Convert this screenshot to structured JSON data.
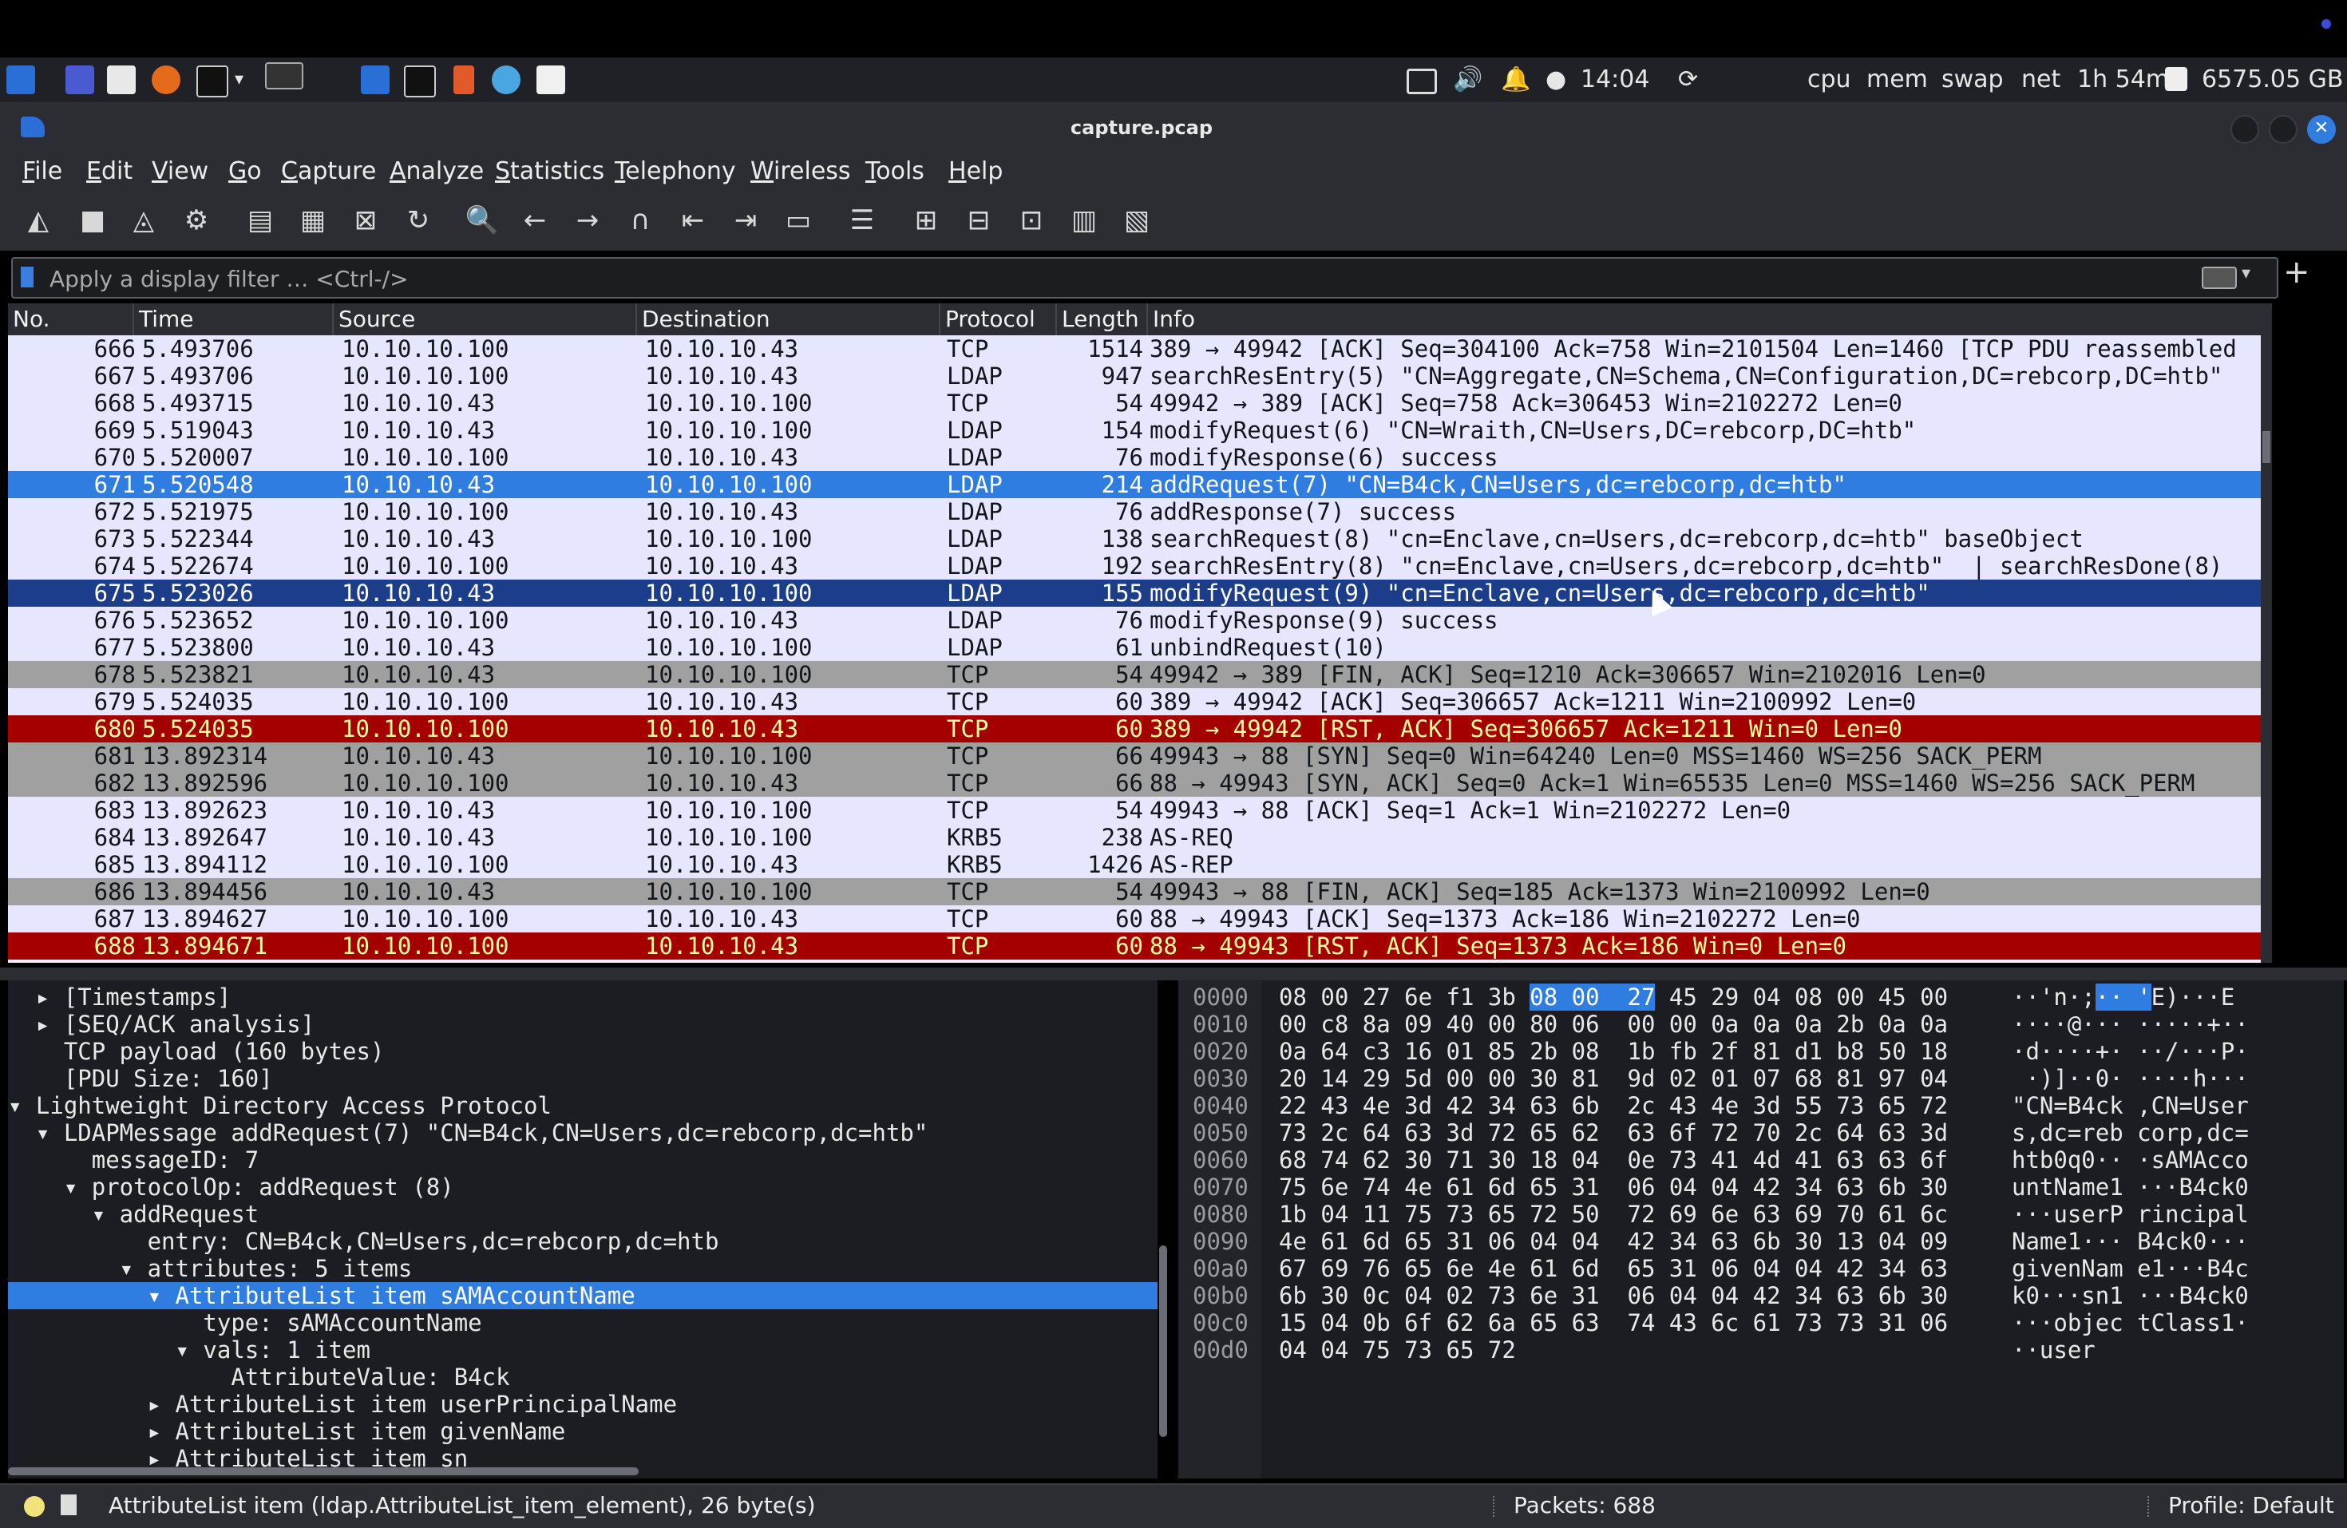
{
  "taskbar": {
    "clock": "14:04",
    "monitors": [
      "cpu",
      "mem",
      "swap",
      "net"
    ],
    "uptime": "1h 54m",
    "disk": "6575.05 GB"
  },
  "window": {
    "title": "capture.pcap"
  },
  "menu": [
    "File",
    "Edit",
    "View",
    "Go",
    "Capture",
    "Analyze",
    "Statistics",
    "Telephony",
    "Wireless",
    "Tools",
    "Help"
  ],
  "filter": {
    "placeholder": "Apply a display filter … <Ctrl-/>"
  },
  "columns": [
    "No.",
    "Time",
    "Source",
    "Destination",
    "Protocol",
    "Length",
    "Info"
  ],
  "packets": [
    {
      "no": "666",
      "time": "5.493706",
      "src": "10.10.10.100",
      "dst": "10.10.10.43",
      "proto": "TCP",
      "len": "1514",
      "info": "389 → 49942 [ACK] Seq=304100 Ack=758 Win=2101504 Len=1460 [TCP PDU reassembled",
      "style": "normal"
    },
    {
      "no": "667",
      "time": "5.493706",
      "src": "10.10.10.100",
      "dst": "10.10.10.43",
      "proto": "LDAP",
      "len": "947",
      "info": "searchResEntry(5) \"CN=Aggregate,CN=Schema,CN=Configuration,DC=rebcorp,DC=htb\"",
      "style": "normal"
    },
    {
      "no": "668",
      "time": "5.493715",
      "src": "10.10.10.43",
      "dst": "10.10.10.100",
      "proto": "TCP",
      "len": "54",
      "info": "49942 → 389 [ACK] Seq=758 Ack=306453 Win=2102272 Len=0",
      "style": "normal"
    },
    {
      "no": "669",
      "time": "5.519043",
      "src": "10.10.10.43",
      "dst": "10.10.10.100",
      "proto": "LDAP",
      "len": "154",
      "info": "modifyRequest(6) \"CN=Wraith,CN=Users,DC=rebcorp,DC=htb\"",
      "style": "normal"
    },
    {
      "no": "670",
      "time": "5.520007",
      "src": "10.10.10.100",
      "dst": "10.10.10.43",
      "proto": "LDAP",
      "len": "76",
      "info": "modifyResponse(6) success",
      "style": "normal"
    },
    {
      "no": "671",
      "time": "5.520548",
      "src": "10.10.10.43",
      "dst": "10.10.10.100",
      "proto": "LDAP",
      "len": "214",
      "info": "addRequest(7) \"CN=B4ck,CN=Users,dc=rebcorp,dc=htb\"",
      "style": "sel1"
    },
    {
      "no": "672",
      "time": "5.521975",
      "src": "10.10.10.100",
      "dst": "10.10.10.43",
      "proto": "LDAP",
      "len": "76",
      "info": "addResponse(7) success",
      "style": "normal"
    },
    {
      "no": "673",
      "time": "5.522344",
      "src": "10.10.10.43",
      "dst": "10.10.10.100",
      "proto": "LDAP",
      "len": "138",
      "info": "searchRequest(8) \"cn=Enclave,cn=Users,dc=rebcorp,dc=htb\" baseObject",
      "style": "normal"
    },
    {
      "no": "674",
      "time": "5.522674",
      "src": "10.10.10.100",
      "dst": "10.10.10.43",
      "proto": "LDAP",
      "len": "192",
      "info": "searchResEntry(8) \"cn=Enclave,cn=Users,dc=rebcorp,dc=htb\"  | searchResDone(8)",
      "style": "normal"
    },
    {
      "no": "675",
      "time": "5.523026",
      "src": "10.10.10.43",
      "dst": "10.10.10.100",
      "proto": "LDAP",
      "len": "155",
      "info": "modifyRequest(9) \"cn=Enclave,cn=Users,dc=rebcorp,dc=htb\"",
      "style": "sel2"
    },
    {
      "no": "676",
      "time": "5.523652",
      "src": "10.10.10.100",
      "dst": "10.10.10.43",
      "proto": "LDAP",
      "len": "76",
      "info": "modifyResponse(9) success",
      "style": "normal"
    },
    {
      "no": "677",
      "time": "5.523800",
      "src": "10.10.10.43",
      "dst": "10.10.10.100",
      "proto": "LDAP",
      "len": "61",
      "info": "unbindRequest(10)",
      "style": "normal"
    },
    {
      "no": "678",
      "time": "5.523821",
      "src": "10.10.10.43",
      "dst": "10.10.10.100",
      "proto": "TCP",
      "len": "54",
      "info": "49942 → 389 [FIN, ACK] Seq=1210 Ack=306657 Win=2102016 Len=0",
      "style": "gray"
    },
    {
      "no": "679",
      "time": "5.524035",
      "src": "10.10.10.100",
      "dst": "10.10.10.43",
      "proto": "TCP",
      "len": "60",
      "info": "389 → 49942 [ACK] Seq=306657 Ack=1211 Win=2100992 Len=0",
      "style": "normal"
    },
    {
      "no": "680",
      "time": "5.524035",
      "src": "10.10.10.100",
      "dst": "10.10.10.43",
      "proto": "TCP",
      "len": "60",
      "info": "389 → 49942 [RST, ACK] Seq=306657 Ack=1211 Win=0 Len=0",
      "style": "red"
    },
    {
      "no": "681",
      "time": "13.892314",
      "src": "10.10.10.43",
      "dst": "10.10.10.100",
      "proto": "TCP",
      "len": "66",
      "info": "49943 → 88 [SYN] Seq=0 Win=64240 Len=0 MSS=1460 WS=256 SACK_PERM",
      "style": "gray"
    },
    {
      "no": "682",
      "time": "13.892596",
      "src": "10.10.10.100",
      "dst": "10.10.10.43",
      "proto": "TCP",
      "len": "66",
      "info": "88 → 49943 [SYN, ACK] Seq=0 Ack=1 Win=65535 Len=0 MSS=1460 WS=256 SACK_PERM",
      "style": "gray"
    },
    {
      "no": "683",
      "time": "13.892623",
      "src": "10.10.10.43",
      "dst": "10.10.10.100",
      "proto": "TCP",
      "len": "54",
      "info": "49943 → 88 [ACK] Seq=1 Ack=1 Win=2102272 Len=0",
      "style": "normal"
    },
    {
      "no": "684",
      "time": "13.892647",
      "src": "10.10.10.43",
      "dst": "10.10.10.100",
      "proto": "KRB5",
      "len": "238",
      "info": "AS-REQ",
      "style": "normal"
    },
    {
      "no": "685",
      "time": "13.894112",
      "src": "10.10.10.100",
      "dst": "10.10.10.43",
      "proto": "KRB5",
      "len": "1426",
      "info": "AS-REP",
      "style": "normal"
    },
    {
      "no": "686",
      "time": "13.894456",
      "src": "10.10.10.43",
      "dst": "10.10.10.100",
      "proto": "TCP",
      "len": "54",
      "info": "49943 → 88 [FIN, ACK] Seq=185 Ack=1373 Win=2100992 Len=0",
      "style": "gray"
    },
    {
      "no": "687",
      "time": "13.894627",
      "src": "10.10.10.100",
      "dst": "10.10.10.43",
      "proto": "TCP",
      "len": "60",
      "info": "88 → 49943 [ACK] Seq=1373 Ack=186 Win=2102272 Len=0",
      "style": "normal"
    },
    {
      "no": "688",
      "time": "13.894671",
      "src": "10.10.10.100",
      "dst": "10.10.10.43",
      "proto": "TCP",
      "len": "60",
      "info": "88 → 49943 [RST, ACK] Seq=1373 Ack=186 Win=0 Len=0",
      "style": "red"
    }
  ],
  "details": [
    {
      "text": "  ▸ [Timestamps]",
      "sel": false
    },
    {
      "text": "  ▸ [SEQ/ACK analysis]",
      "sel": false
    },
    {
      "text": "    TCP payload (160 bytes)",
      "sel": false
    },
    {
      "text": "    [PDU Size: 160]",
      "sel": false
    },
    {
      "text": "▾ Lightweight Directory Access Protocol",
      "sel": false
    },
    {
      "text": "  ▾ LDAPMessage addRequest(7) \"CN=B4ck,CN=Users,dc=rebcorp,dc=htb\"",
      "sel": false
    },
    {
      "text": "      messageID: 7",
      "sel": false
    },
    {
      "text": "    ▾ protocolOp: addRequest (8)",
      "sel": false
    },
    {
      "text": "      ▾ addRequest",
      "sel": false
    },
    {
      "text": "          entry: CN=B4ck,CN=Users,dc=rebcorp,dc=htb",
      "sel": false
    },
    {
      "text": "        ▾ attributes: 5 items",
      "sel": false
    },
    {
      "text": "          ▾ AttributeList item sAMAccountName",
      "sel": true
    },
    {
      "text": "              type: sAMAccountName",
      "sel": false
    },
    {
      "text": "            ▾ vals: 1 item",
      "sel": false
    },
    {
      "text": "                AttributeValue: B4ck",
      "sel": false
    },
    {
      "text": "          ▸ AttributeList item userPrincipalName",
      "sel": false
    },
    {
      "text": "          ▸ AttributeList item givenName",
      "sel": false
    },
    {
      "text": "          ▸ AttributeList item sn",
      "sel": false
    }
  ],
  "hex": [
    {
      "off": "0000",
      "bytes": "08 00 27 6e f1 3b ",
      "hl": "08 00  27",
      "bytes2": " 45 29 04 08 00 45 00",
      "asc_a": "··'n·;",
      "asc_hl": "·· '",
      "asc_b": "E)···E"
    },
    {
      "off": "0010",
      "bytes": "00 c8 8a 09 40 00 80 06  00 00 0a 0a 0a 2b 0a 0a",
      "hl": "",
      "bytes2": "",
      "asc_a": "····@··· ·····+··",
      "asc_hl": "",
      "asc_b": ""
    },
    {
      "off": "0020",
      "bytes": "0a 64 c3 16 01 85 2b 08  1b fb 2f 81 d1 b8 50 18",
      "hl": "",
      "bytes2": "",
      "asc_a": "·d····+· ··/···P·",
      "asc_hl": "",
      "asc_b": ""
    },
    {
      "off": "0030",
      "bytes": "20 14 29 5d 00 00 30 81  9d 02 01 07 68 81 97 04",
      "hl": "",
      "bytes2": "",
      "asc_a": " ·)]··0· ····h···",
      "asc_hl": "",
      "asc_b": ""
    },
    {
      "off": "0040",
      "bytes": "22 43 4e 3d 42 34 63 6b  2c 43 4e 3d 55 73 65 72",
      "hl": "",
      "bytes2": "",
      "asc_a": "\"CN=B4ck ,CN=User",
      "asc_hl": "",
      "asc_b": ""
    },
    {
      "off": "0050",
      "bytes": "73 2c 64 63 3d 72 65 62  63 6f 72 70 2c 64 63 3d",
      "hl": "",
      "bytes2": "",
      "asc_a": "s,dc=reb corp,dc=",
      "asc_hl": "",
      "asc_b": ""
    },
    {
      "off": "0060",
      "bytes": "68 74 62 30 71 30 18 04  0e 73 41 4d 41 63 63 6f",
      "hl": "",
      "bytes2": "",
      "asc_a": "htb0q0·· ·sAMAcco",
      "asc_hl": "",
      "asc_b": ""
    },
    {
      "off": "0070",
      "bytes": "75 6e 74 4e 61 6d 65 31  06 04 04 42 34 63 6b 30",
      "hl": "",
      "bytes2": "",
      "asc_a": "untName1 ···B4ck0",
      "asc_hl": "",
      "asc_b": ""
    },
    {
      "off": "0080",
      "bytes": "1b 04 11 75 73 65 72 50  72 69 6e 63 69 70 61 6c",
      "hl": "",
      "bytes2": "",
      "asc_a": "···userP rincipal",
      "asc_hl": "",
      "asc_b": ""
    },
    {
      "off": "0090",
      "bytes": "4e 61 6d 65 31 06 04 04  42 34 63 6b 30 13 04 09",
      "hl": "",
      "bytes2": "",
      "asc_a": "Name1··· B4ck0···",
      "asc_hl": "",
      "asc_b": ""
    },
    {
      "off": "00a0",
      "bytes": "67 69 76 65 6e 4e 61 6d  65 31 06 04 04 42 34 63",
      "hl": "",
      "bytes2": "",
      "asc_a": "givenNam e1···B4c",
      "asc_hl": "",
      "asc_b": ""
    },
    {
      "off": "00b0",
      "bytes": "6b 30 0c 04 02 73 6e 31  06 04 04 42 34 63 6b 30",
      "hl": "",
      "bytes2": "",
      "asc_a": "k0···sn1 ···B4ck0",
      "asc_hl": "",
      "asc_b": ""
    },
    {
      "off": "00c0",
      "bytes": "15 04 0b 6f 62 6a 65 63  74 43 6c 61 73 73 31 06",
      "hl": "",
      "bytes2": "",
      "asc_a": "···objec tClass1·",
      "asc_hl": "",
      "asc_b": ""
    },
    {
      "off": "00d0",
      "bytes": "04 04 75 73 65 72",
      "hl": "",
      "bytes2": "",
      "asc_a": "··user",
      "asc_hl": "",
      "asc_b": ""
    }
  ],
  "status": {
    "field": "AttributeList item (ldap.AttributeList_item_element), 26 byte(s)",
    "packets": "Packets: 688",
    "profile": "Profile: Default"
  },
  "colors": {
    "selected": "#2f7de1",
    "selected_dark": "#1c3e8a",
    "error_row": "#a40000",
    "row_bg": "#e7e6ff"
  }
}
